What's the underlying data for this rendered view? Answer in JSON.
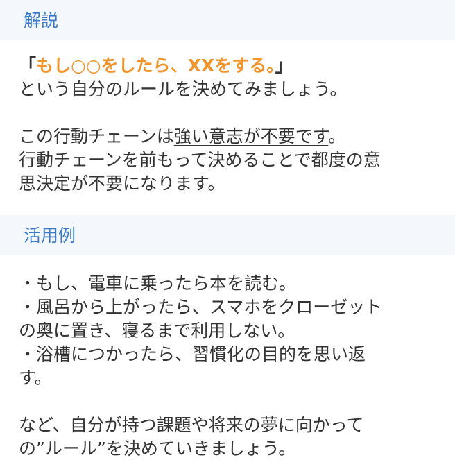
{
  "section1": {
    "title": "解説",
    "rule": {
      "open_bracket": "「",
      "highlight": "もし○○をしたら、XXをする。",
      "close_bracket": "」"
    },
    "line2": "という自分のルールを決めてみましょう。",
    "line3_before": "この行動チェーンは",
    "line3_underline": "強い意志が不要です",
    "line3_after": "。",
    "line4": "行動チェーンを前もって決めることで都度の意",
    "line5": "思決定が不要になります。"
  },
  "section2": {
    "title": "活用例",
    "lines": [
      "・もし、電車に乗ったら本を読む。",
      "・風呂から上がったら、スマホをクローゼット",
      "の奥に置き、寝るまで利用しない。",
      "・浴槽につかったら、習慣化の目的を思い返",
      "す。",
      "",
      "など、自分が持つ課題や将来の夢に向かって",
      "の”ルール”を決めていきましょう。"
    ]
  }
}
